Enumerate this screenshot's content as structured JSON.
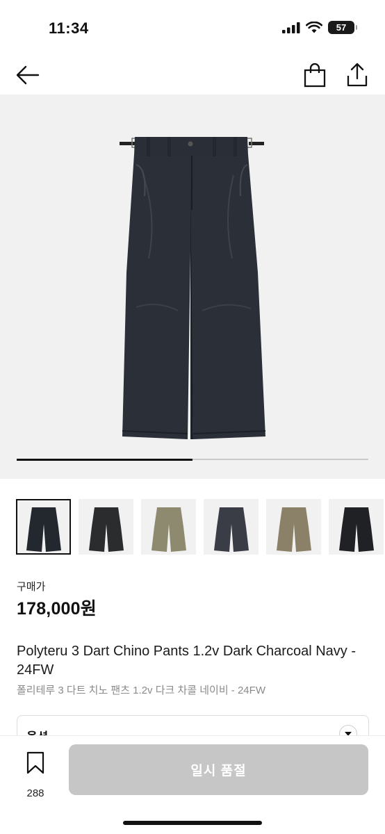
{
  "status_bar": {
    "time": "11:34",
    "battery": "57",
    "icons": [
      "cellular-signal-icon",
      "wifi-icon",
      "battery-icon"
    ]
  },
  "nav": {
    "icons": [
      "back-arrow-icon",
      "shopping-bag-icon",
      "share-icon"
    ]
  },
  "gallery": {
    "progress": 0.5,
    "thumbnail_colors": [
      "#23272e",
      "#2b2c2e",
      "#8e8a70",
      "#3a3d46",
      "#8a8168",
      "#1f2124"
    ],
    "active_index": 0
  },
  "product": {
    "price_label": "구매가",
    "price": "178,000원",
    "title_en": "Polyteru 3 Dart Chino Pants 1.2v Dark Charcoal Navy - 24FW",
    "title_ko": "폴리테루 3 다트 치노 팬츠 1.2v 다크 차콜 네이비 - 24FW"
  },
  "option": {
    "label": "옵션"
  },
  "bottom_bar": {
    "wishlist_count": "288",
    "button_label": "일시 품절"
  },
  "colors": {
    "accent": "#111111",
    "disabled_button": "#c6c6c6",
    "hero_bg": "#f1f1f1"
  }
}
